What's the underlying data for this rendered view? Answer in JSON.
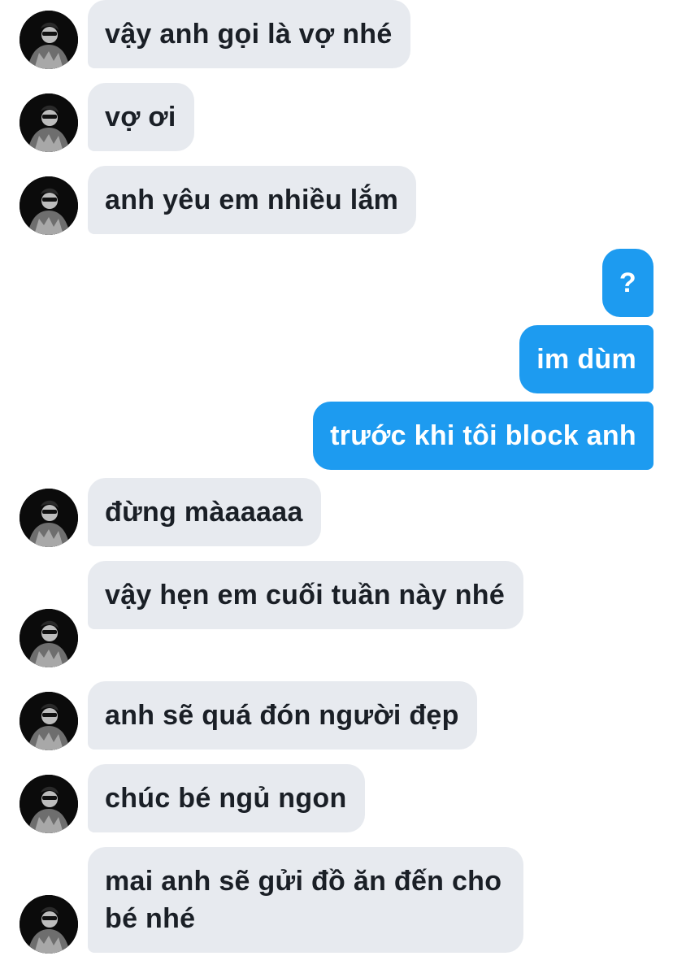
{
  "conversation": {
    "messages": [
      {
        "sender": "them",
        "text": "vậy anh gọi là vợ nhé"
      },
      {
        "sender": "them",
        "text": "vợ ơi"
      },
      {
        "sender": "them",
        "text": "anh yêu em nhiều lắm"
      },
      {
        "sender": "me",
        "text": "?"
      },
      {
        "sender": "me",
        "text": "im dùm"
      },
      {
        "sender": "me",
        "text": "trước khi tôi block anh"
      },
      {
        "sender": "them",
        "text": "đừng màaaaaa"
      },
      {
        "sender": "them",
        "text": "vậy hẹn em cuối tuần này nhé"
      },
      {
        "sender": "them",
        "text": "anh sẽ quá đón người đẹp"
      },
      {
        "sender": "them",
        "text": "chúc bé ngủ ngon"
      },
      {
        "sender": "them",
        "text": "mai anh sẽ gửi đồ ăn đến cho bé nhé"
      }
    ]
  },
  "colors": {
    "incoming_bubble": "#e7eaef",
    "incoming_text": "#1a1f26",
    "outgoing_bubble": "#1d9bf0",
    "outgoing_text": "#ffffff",
    "background": "#ffffff"
  },
  "icons": {
    "avatar": "profile-photo-icon"
  }
}
